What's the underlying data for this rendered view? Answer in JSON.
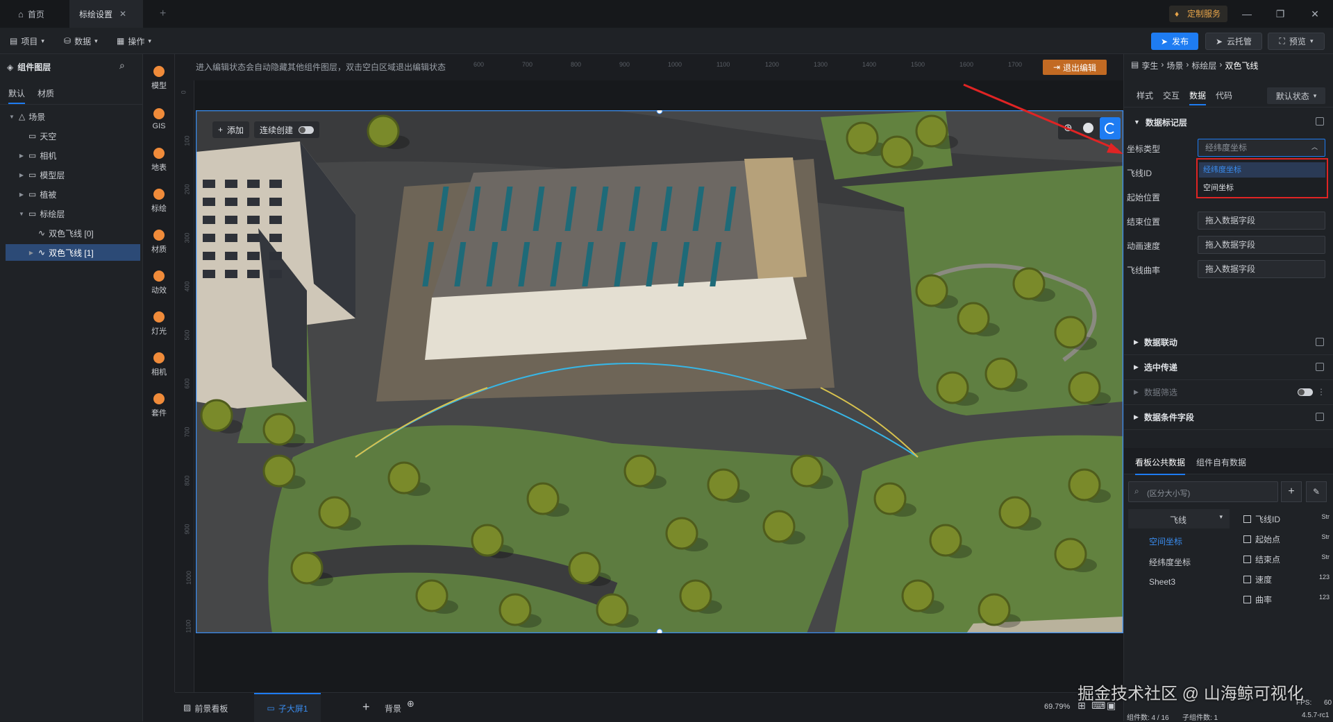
{
  "titlebar": {
    "home_tab": "首页",
    "settings_tab": "标绘设置",
    "custom_service": "定制服务"
  },
  "toolbar": {
    "project_menu": "项目",
    "data_menu": "数据",
    "operate_menu": "操作",
    "publish_button": "发布",
    "cloud_button": "云托管",
    "preview_button": "预览"
  },
  "left_panel": {
    "title": "组件图层",
    "tabs": [
      "默认",
      "材质"
    ],
    "tree": [
      {
        "label": "场景",
        "level": 0,
        "expanded": true
      },
      {
        "label": "天空",
        "level": 1
      },
      {
        "label": "相机",
        "level": 1
      },
      {
        "label": "模型层",
        "level": 1
      },
      {
        "label": "植被",
        "level": 1
      },
      {
        "label": "标绘层",
        "level": 1,
        "expanded": true
      },
      {
        "label": "双色飞线 [0]",
        "level": 2
      },
      {
        "label": "双色飞线 [1]",
        "level": 2,
        "selected": true
      }
    ]
  },
  "tools": [
    "模型",
    "GIS",
    "地表",
    "标绘",
    "材质",
    "动效",
    "灯光",
    "相机",
    "套件"
  ],
  "canvas": {
    "hint": "进入编辑状态会自动隐藏其他组件图层，双击空白区域退出编辑状态",
    "exit_edit": "退出编辑",
    "add_button": "添加",
    "continuous_create": "连续创建",
    "ruler_top": [
      "600",
      "700",
      "800",
      "900",
      "1000",
      "1100",
      "1200",
      "1300",
      "1400",
      "1500",
      "1600",
      "1700",
      "1800"
    ],
    "ruler_left": [
      "0",
      "100",
      "200",
      "300",
      "400",
      "500",
      "600",
      "700",
      "800",
      "900",
      "1000",
      "1100"
    ]
  },
  "right_panel": {
    "breadcrumb": [
      "孪生",
      "场景",
      "标绘层",
      "双色飞线"
    ],
    "tabs": [
      "样式",
      "交互",
      "数据",
      "代码"
    ],
    "state_select": "默认状态",
    "section_data_layer": "数据标记层",
    "fields": [
      {
        "label": "坐标类型",
        "value": "经纬度坐标"
      },
      {
        "label": "飞线ID",
        "value": ""
      },
      {
        "label": "起始位置",
        "value": ""
      },
      {
        "label": "结束位置",
        "value": "拖入数据字段"
      },
      {
        "label": "动画速度",
        "value": "拖入数据字段"
      },
      {
        "label": "飞线曲率",
        "value": "拖入数据字段"
      }
    ],
    "dropdown_options": [
      "经纬度坐标",
      "空间坐标"
    ],
    "sections": [
      "数据联动",
      "选中传递",
      "数据筛选",
      "数据条件字段"
    ],
    "bottom_tabs": [
      "看板公共数据",
      "组件自有数据"
    ],
    "search_placeholder": "(区分大小写)",
    "dataset_select": "飞线",
    "datasets": [
      "空间坐标",
      "经纬度坐标",
      "Sheet3"
    ],
    "fields_list": [
      {
        "name": "飞线ID",
        "type": "Str"
      },
      {
        "name": "起始点",
        "type": "Str"
      },
      {
        "name": "结束点",
        "type": "Str"
      },
      {
        "name": "速度",
        "type": "123"
      },
      {
        "name": "曲率",
        "type": "123"
      }
    ],
    "status_line1": "4.5.7-rc1",
    "status_line2_components": "组件数: 4 / 16",
    "status_line2_sub": "子组件数: 1",
    "fps_label": "FPS:",
    "fps_value": "60"
  },
  "bottom_bar": {
    "front_board": "前景看板",
    "sub_screen": "子大屏1",
    "background": "背景",
    "zoom": "69.79%"
  },
  "watermark": "掘金技术社区 @ 山海鲸可视化",
  "colors": {
    "accent": "#1e7cf2",
    "orange": "#f08b3a",
    "danger": "#e02424"
  }
}
